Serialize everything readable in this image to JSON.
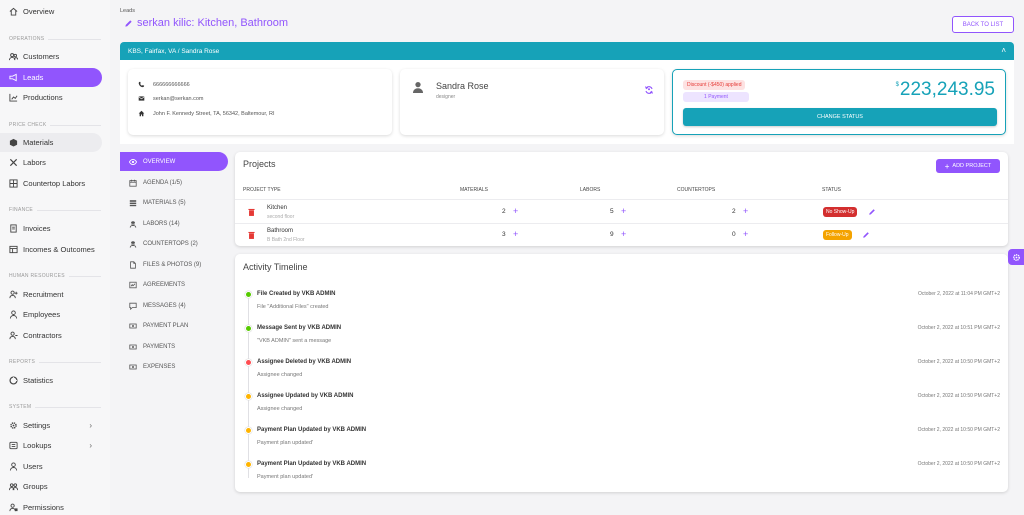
{
  "sidebar": {
    "sections": [
      "OPERATIONS",
      "PRICE CHECK",
      "FINANCE",
      "HUMAN RESOURCES",
      "REPORTS",
      "SYSTEM"
    ],
    "items": [
      "Overview",
      "Customers",
      "Leads",
      "Productions",
      "Materials",
      "Labors",
      "Countertop Labors",
      "Invoices",
      "Incomes & Outcomes",
      "Recruitment",
      "Employees",
      "Contractors",
      "Statistics",
      "Settings",
      "Lookups",
      "Users",
      "Groups",
      "Permissions"
    ]
  },
  "header": {
    "breadcrumb": "Leads",
    "title": "serkan kilic: Kitchen, Bathroom",
    "back_label": "BACK TO LIST"
  },
  "lead_bar": {
    "label": "KBS, Fairfax, VA / Sandra Rose"
  },
  "contact": {
    "phone": "666666666666",
    "email": "serkan@serkan.com",
    "address": "John F. Kennedy Street, TA, 56342, Baltemour, RI"
  },
  "assignee": {
    "name": "Sandra Rose",
    "role": "designer"
  },
  "summary": {
    "discount": "Discount (-$450) applied",
    "payment": "1 Payment",
    "currency": "$",
    "amount": "223,243.95",
    "change_status": "CHANGE STATUS"
  },
  "tabs": [
    "OVERVIEW",
    "AGENDA (1/5)",
    "MATERIALS (5)",
    "LABORS (14)",
    "COUNTERTOPS (2)",
    "FILES & PHOTOS (9)",
    "AGREEMENTS",
    "MESSAGES (4)",
    "PAYMENT PLAN",
    "PAYMENTS",
    "EXPENSES"
  ],
  "projects": {
    "title": "Projects",
    "add_label": "ADD PROJECT",
    "columns": [
      "PROJECT TYPE",
      "MATERIALS",
      "LABORS",
      "COUNTERTOPS",
      "STATUS"
    ],
    "rows": [
      {
        "name": "Kitchen",
        "sub": "second floor",
        "materials": "2",
        "labors": "5",
        "countertops": "2",
        "status": "No Show-Up",
        "status_color": "#d32f2f"
      },
      {
        "name": "Bathroom",
        "sub": "B Bath 2nd Floor",
        "materials": "3",
        "labors": "9",
        "countertops": "0",
        "status": "Follow-Up",
        "status_color": "#f4a300"
      }
    ]
  },
  "timeline": {
    "title": "Activity Timeline",
    "events": [
      {
        "title": "File Created by VKB ADMIN",
        "desc": "File  \"Additional Files\" created",
        "date": "October 2, 2022 at 11:04 PM GMT+2",
        "color": "#56ca00"
      },
      {
        "title": "Message Sent by VKB ADMIN",
        "desc": "\"VKB ADMIN\" sent a message",
        "date": "October 2, 2022 at 10:51 PM GMT+2",
        "color": "#56ca00"
      },
      {
        "title": "Assignee Deleted by VKB ADMIN",
        "desc": "Assignee changed",
        "date": "October 2, 2022 at 10:50 PM GMT+2",
        "color": "#ff4c51"
      },
      {
        "title": "Assignee Updated by VKB ADMIN",
        "desc": "Assignee changed",
        "date": "October 2, 2022 at 10:50 PM GMT+2",
        "color": "#ffb400"
      },
      {
        "title": "Payment Plan Updated by VKB ADMIN",
        "desc": "Payment plan updated'",
        "date": "October 2, 2022 at 10:50 PM GMT+2",
        "color": "#ffb400"
      },
      {
        "title": "Payment Plan Updated by VKB ADMIN",
        "desc": "Payment plan updated'",
        "date": "October 2, 2022 at 10:50 PM GMT+2",
        "color": "#ffb400"
      }
    ]
  },
  "colors": {
    "accent": "#9155fd",
    "teal": "#16a2b8"
  }
}
